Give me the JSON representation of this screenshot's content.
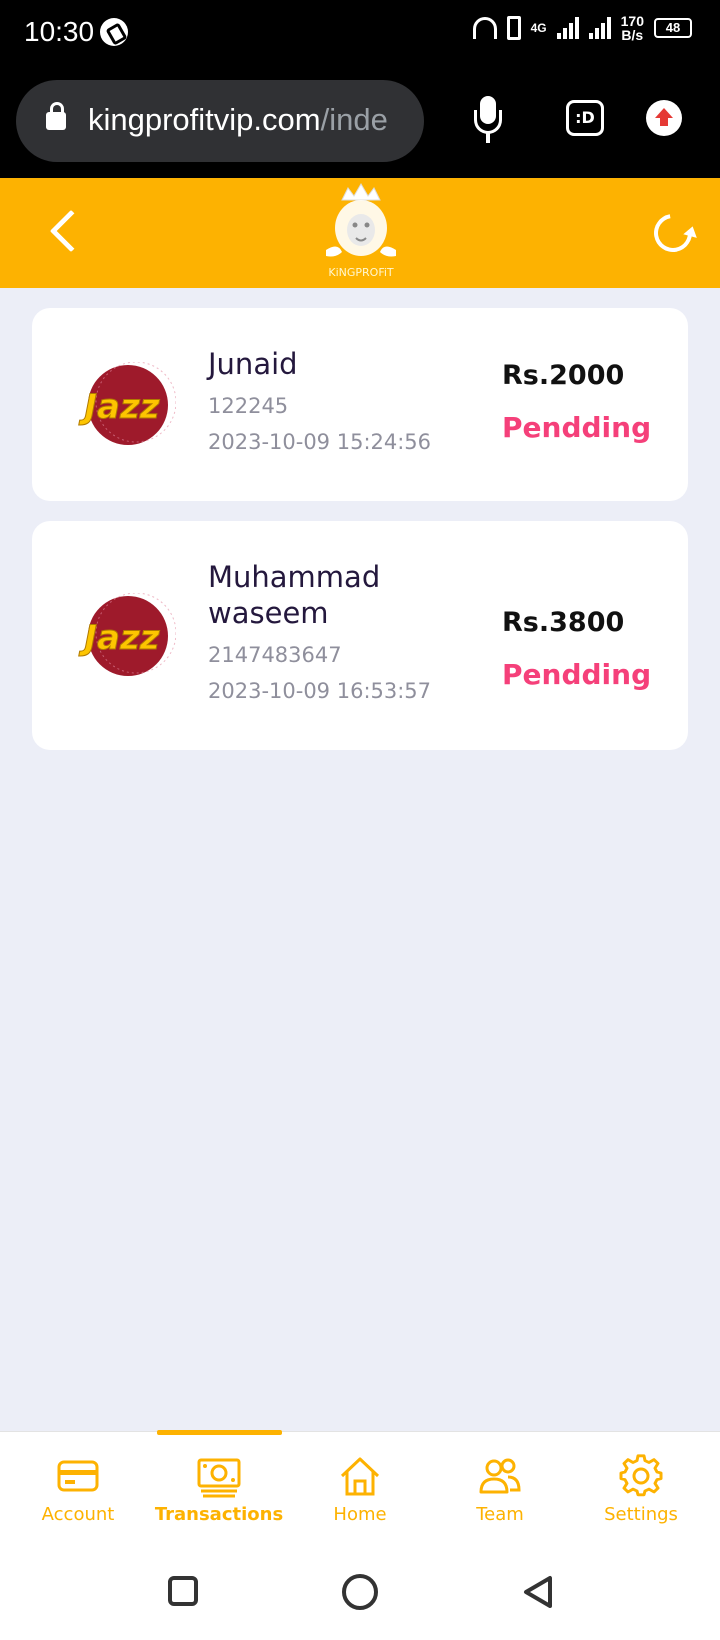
{
  "status_bar": {
    "time": "10:30",
    "network_type": "4G",
    "net_speed_value": "170",
    "net_speed_unit": "B/s",
    "battery": "48"
  },
  "browser": {
    "url_main": "kingprofitvip.com",
    "url_rest": "/inde",
    "tabs_label": ":D"
  },
  "header": {
    "logo_text": "KiNGPROFiT"
  },
  "transactions": [
    {
      "name": "Junaid",
      "number": "122245",
      "date": "2023-10-09 15:24:56",
      "amount": "Rs.2000",
      "status": "Pendding",
      "provider_logo_text": "Jazz"
    },
    {
      "name": "Muhammad waseem",
      "number": "2147483647",
      "date": "2023-10-09 16:53:57",
      "amount": "Rs.3800",
      "status": "Pendding",
      "provider_logo_text": "Jazz"
    }
  ],
  "bottom_nav": {
    "items": [
      {
        "label": "Account",
        "icon": "card-icon"
      },
      {
        "label": "Transactions",
        "icon": "cash-icon",
        "active": true
      },
      {
        "label": "Home",
        "icon": "home-icon"
      },
      {
        "label": "Team",
        "icon": "team-icon"
      },
      {
        "label": "Settings",
        "icon": "gear-icon"
      }
    ]
  },
  "colors": {
    "accent": "#fdb201",
    "status_pending": "#f5407a",
    "background": "#eceef7"
  }
}
